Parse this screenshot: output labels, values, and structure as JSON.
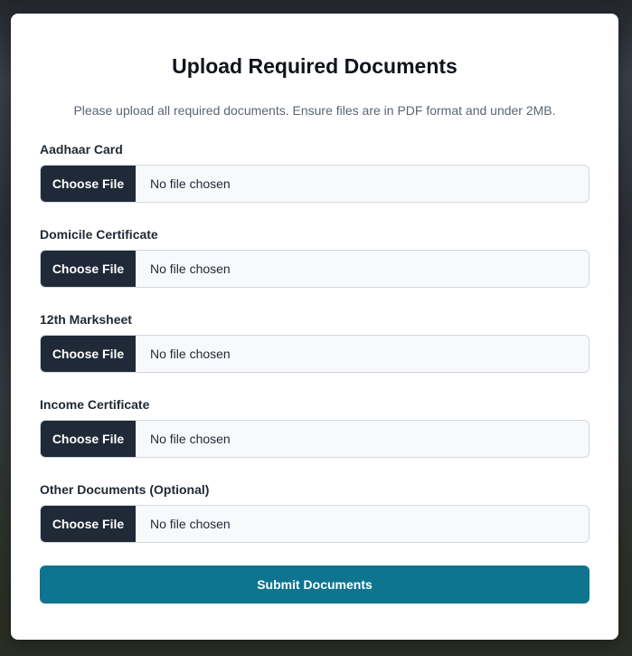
{
  "header": {
    "title": "Upload Required Documents",
    "subtitle": "Please upload all required documents. Ensure files are in PDF format and under 2MB."
  },
  "fields": [
    {
      "label": "Aadhaar Card",
      "button_label": "Choose File",
      "status": "No file chosen"
    },
    {
      "label": "Domicile Certificate",
      "button_label": "Choose File",
      "status": "No file chosen"
    },
    {
      "label": "12th Marksheet",
      "button_label": "Choose File",
      "status": "No file chosen"
    },
    {
      "label": "Income Certificate",
      "button_label": "Choose File",
      "status": "No file chosen"
    },
    {
      "label": "Other Documents (Optional)",
      "button_label": "Choose File",
      "status": "No file chosen"
    }
  ],
  "submit": {
    "label": "Submit Documents"
  },
  "colors": {
    "choose_button": "#1f2937",
    "submit_button": "#0e7490",
    "card_background": "#ffffff"
  }
}
